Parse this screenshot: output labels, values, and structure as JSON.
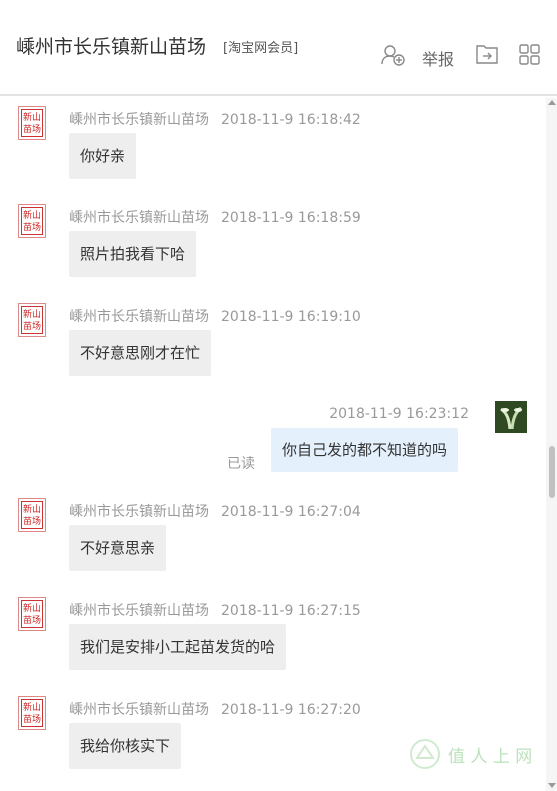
{
  "header": {
    "title": "嵊州市长乐镇新山苗场",
    "badge": "[淘宝网会员]",
    "report_label": "举报",
    "icons": [
      "add-contact-icon",
      "share-out-icon",
      "grid-icon"
    ]
  },
  "shop_avatar_text": "新山苗场",
  "messages": [
    {
      "sender": "嵊州市长乐镇新山苗场",
      "time": "2018-11-9 16:18:42",
      "text": "你好亲"
    },
    {
      "sender": "嵊州市长乐镇新山苗场",
      "time": "2018-11-9 16:18:59",
      "text": "照片拍我看下哈"
    },
    {
      "sender": "嵊州市长乐镇新山苗场",
      "time": "2018-11-9 16:19:10",
      "text": "不好意思刚才在忙"
    },
    {
      "sender": "",
      "time": "2018-11-9 16:23:12",
      "text": "你自己发的都不知道的吗",
      "status": "已读"
    },
    {
      "sender": "嵊州市长乐镇新山苗场",
      "time": "2018-11-9 16:27:04",
      "text": "不好意思亲"
    },
    {
      "sender": "嵊州市长乐镇新山苗场",
      "time": "2018-11-9 16:27:15",
      "text": "我们是安排小工起苗发货的哈"
    },
    {
      "sender": "嵊州市长乐镇新山苗场",
      "time": "2018-11-9 16:27:20",
      "text": "我给你核实下"
    }
  ],
  "watermark": "值 人 上 网",
  "colors": {
    "my_bubble": "#e4f0fb",
    "their_bubble": "#eeeeee",
    "seal_red": "#c22222"
  }
}
